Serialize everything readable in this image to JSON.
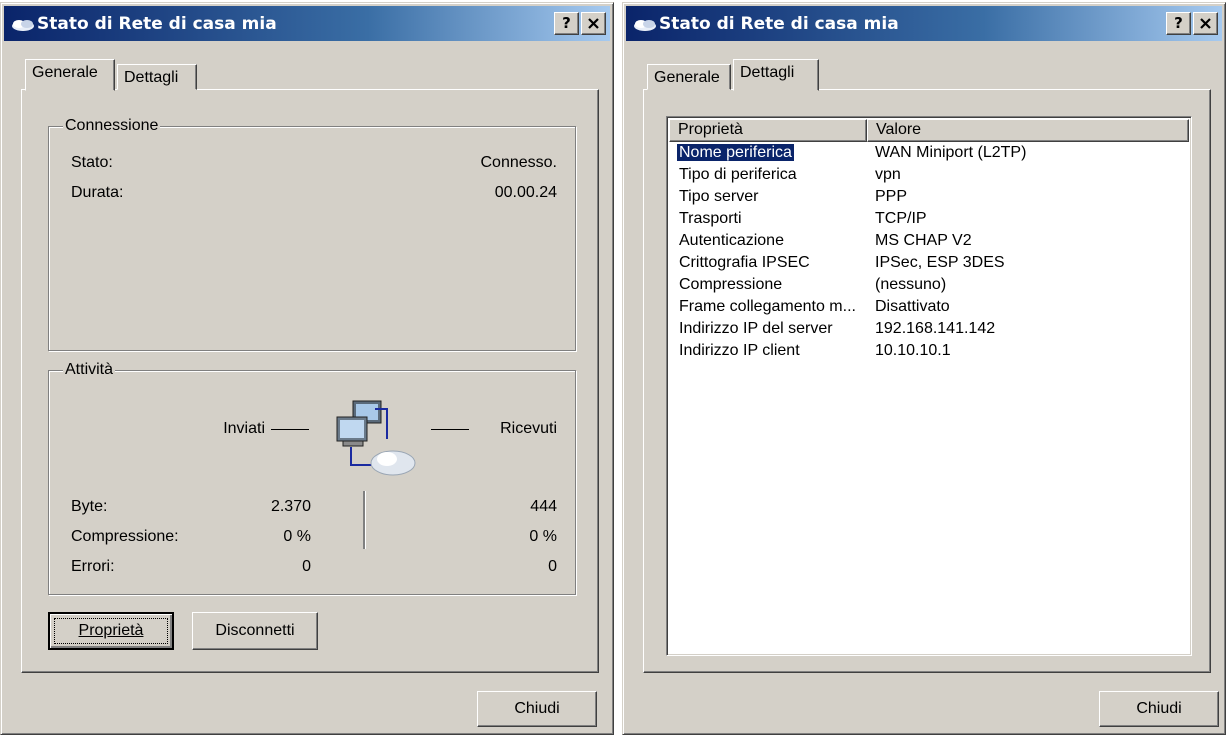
{
  "left_window": {
    "title": "Stato di Rete di casa mia",
    "help_btn": "?",
    "close_btn": "✕",
    "tabs": [
      {
        "label": "Generale",
        "active": true
      },
      {
        "label": "Dettagli",
        "active": false
      }
    ],
    "connection": {
      "legend": "Connessione",
      "status_label": "Stato:",
      "status_value": "Connesso.",
      "duration_label": "Durata:",
      "duration_value": "00.00.24"
    },
    "activity": {
      "legend": "Attività",
      "sent_label": "Inviati",
      "received_label": "Ricevuti",
      "rows": [
        {
          "label": "Byte:",
          "sent": "2.370",
          "received": "444"
        },
        {
          "label": "Compressione:",
          "sent": "0 %",
          "received": "0 %"
        },
        {
          "label": "Errori:",
          "sent": "0",
          "received": "0"
        }
      ]
    },
    "buttons": {
      "properties": "Proprietà",
      "disconnect": "Disconnetti",
      "close": "Chiudi"
    }
  },
  "right_window": {
    "title": "Stato di Rete di casa mia",
    "help_btn": "?",
    "close_btn": "✕",
    "tabs": [
      {
        "label": "Generale",
        "active": false
      },
      {
        "label": "Dettagli",
        "active": true
      }
    ],
    "details": {
      "columns": [
        "Proprietà",
        "Valore"
      ],
      "rows": [
        {
          "property": "Nome periferica",
          "value": "WAN Miniport (L2TP)",
          "selected": true
        },
        {
          "property": "Tipo di periferica",
          "value": "vpn"
        },
        {
          "property": "Tipo server",
          "value": "PPP"
        },
        {
          "property": "Trasporti",
          "value": "TCP/IP"
        },
        {
          "property": "Autenticazione",
          "value": "MS CHAP V2"
        },
        {
          "property": "Crittografia IPSEC",
          "value": "IPSec, ESP 3DES"
        },
        {
          "property": "Compressione",
          "value": "(nessuno)"
        },
        {
          "property": "Frame collegamento m...",
          "value": "Disattivato"
        },
        {
          "property": "Indirizzo IP del server",
          "value": "192.168.141.142"
        },
        {
          "property": "Indirizzo IP client",
          "value": "10.10.10.1"
        }
      ]
    },
    "buttons": {
      "close": "Chiudi"
    }
  },
  "colors": {
    "face": "#d4d0c8",
    "title_start": "#0a246a",
    "title_end": "#a6caf0",
    "selection": "#0a246a"
  }
}
